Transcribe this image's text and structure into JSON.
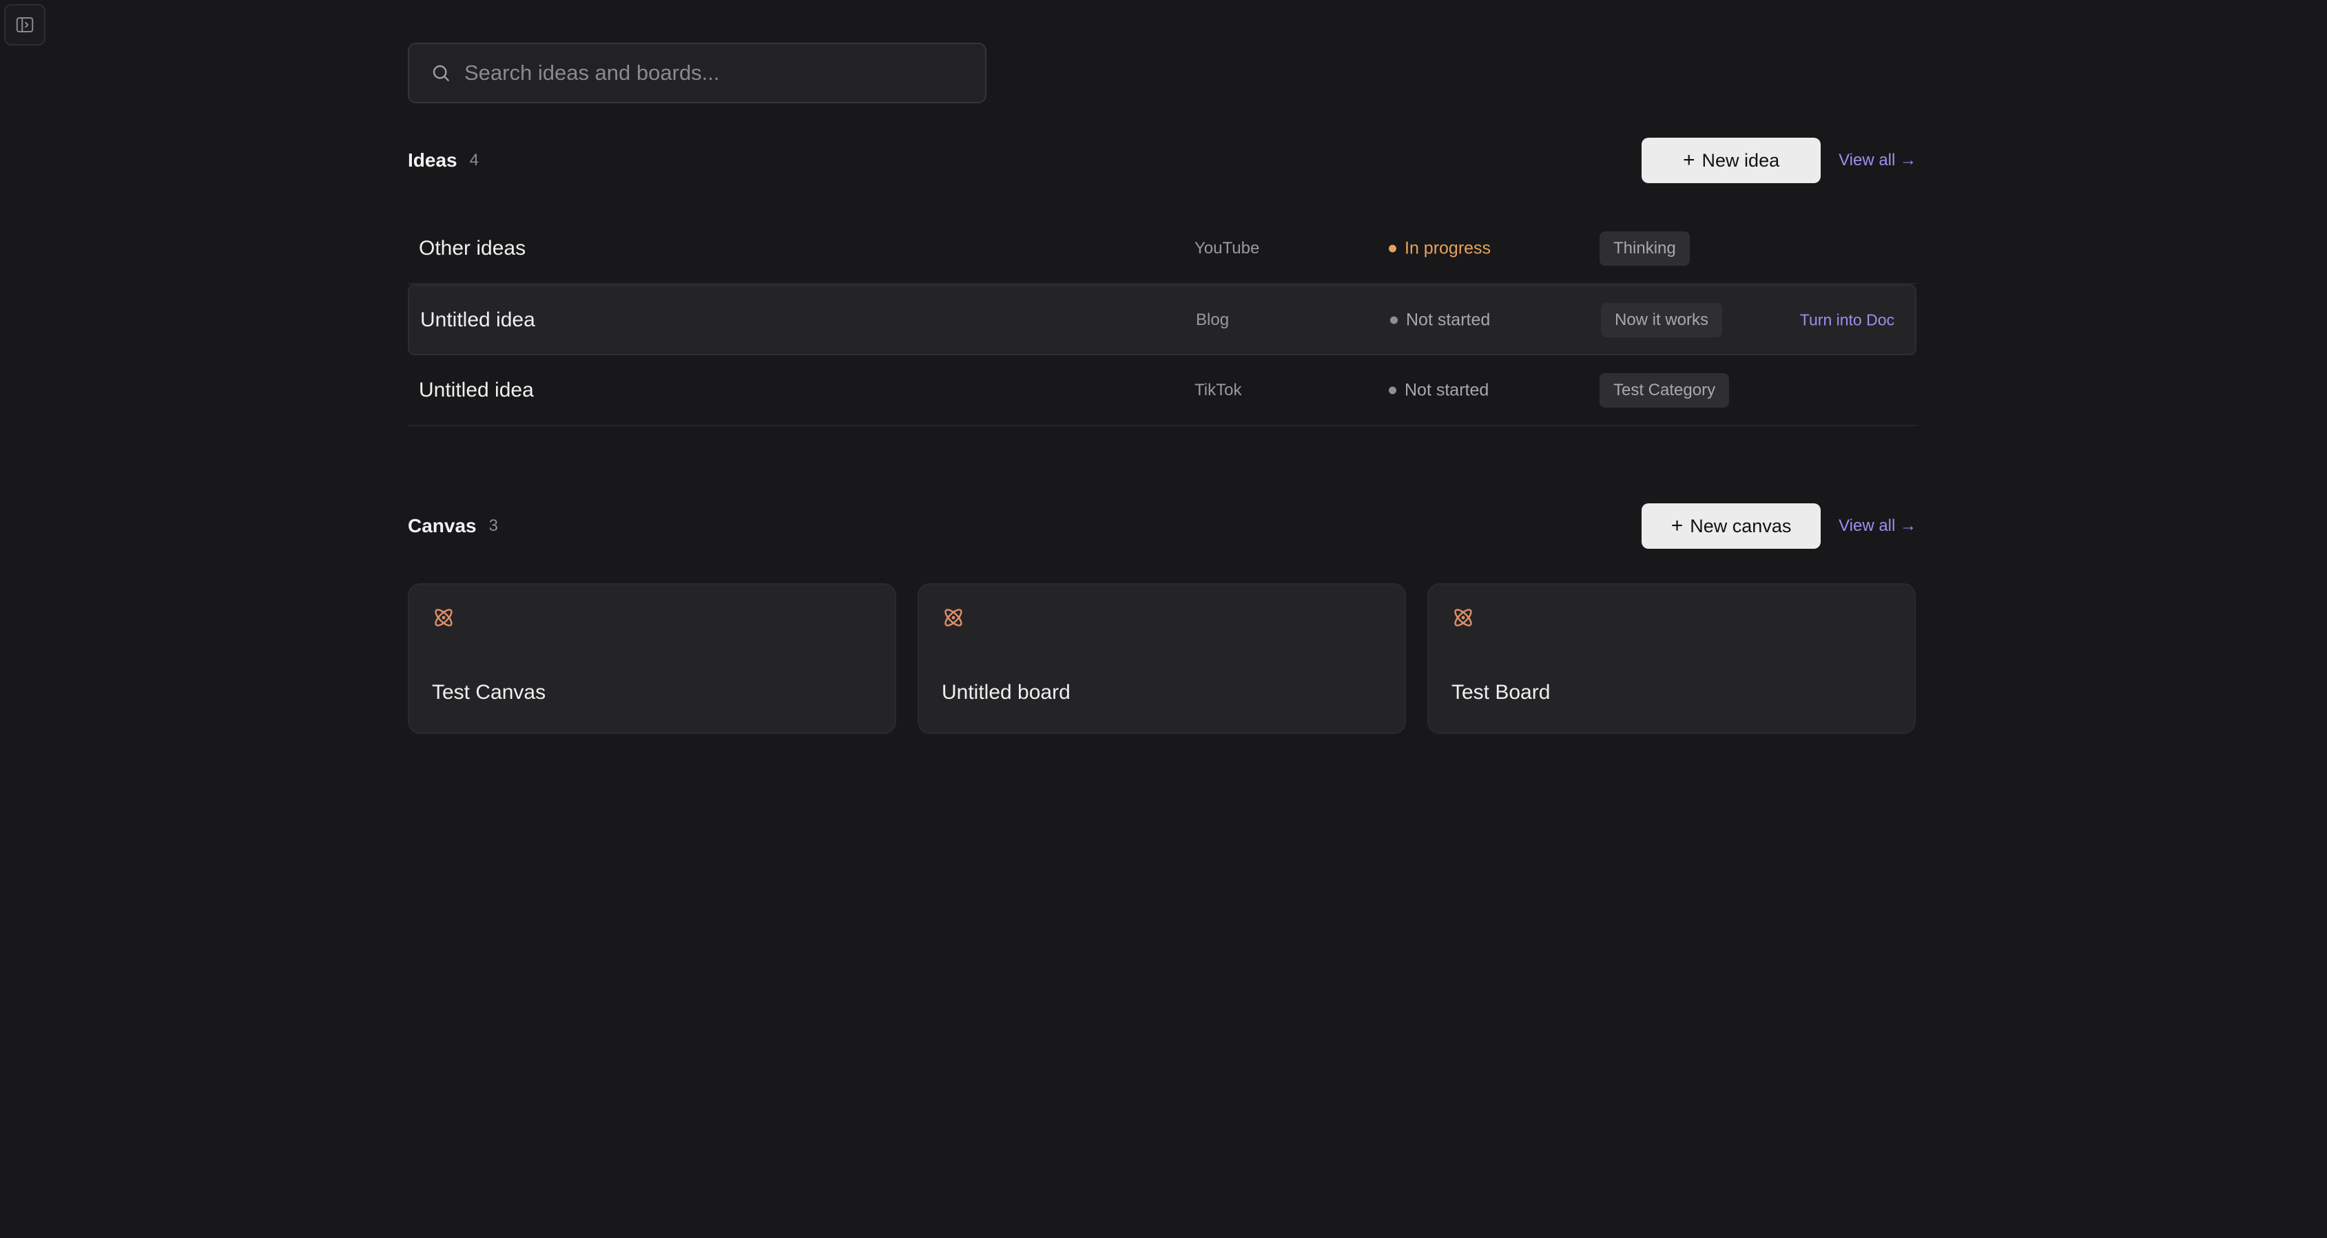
{
  "sidebar_toggle": {
    "icon": "sidebar-toggle-icon"
  },
  "search": {
    "placeholder": "Search ideas and boards...",
    "value": "",
    "icon": "search-icon"
  },
  "ideas": {
    "title": "Ideas",
    "count": "4",
    "new_button": {
      "icon": "+",
      "label": "New idea"
    },
    "view_all": "View all →",
    "rows": [
      {
        "title": "Other ideas",
        "platform": "YouTube",
        "status": "In progress",
        "status_color": "#e8a15c",
        "status_text_color": "#e8a15c",
        "tag": "Thinking",
        "action": ""
      },
      {
        "title": "Untitled idea",
        "platform": "Blog",
        "status": "Not started",
        "status_color": "#8f8f94",
        "status_text_color": "#a8a8ad",
        "tag": "Now it works",
        "action": "Turn into Doc"
      },
      {
        "title": "Untitled idea",
        "platform": "TikTok",
        "status": "Not started",
        "status_color": "#8f8f94",
        "status_text_color": "#a8a8ad",
        "tag": "Test Category",
        "action": ""
      }
    ]
  },
  "canvas": {
    "title": "Canvas",
    "count": "3",
    "new_button": {
      "icon": "+",
      "label": "New canvas"
    },
    "view_all": "View all →",
    "cards": [
      {
        "title": "Test Canvas",
        "icon": "atom-icon"
      },
      {
        "title": "Untitled board",
        "icon": "atom-icon"
      },
      {
        "title": "Test Board",
        "icon": "atom-icon"
      }
    ]
  },
  "colors": {
    "background": "#18181a",
    "accent_link": "#9b90f0",
    "in_progress": "#e8a15c",
    "canvas_icon": "#e0906a"
  }
}
